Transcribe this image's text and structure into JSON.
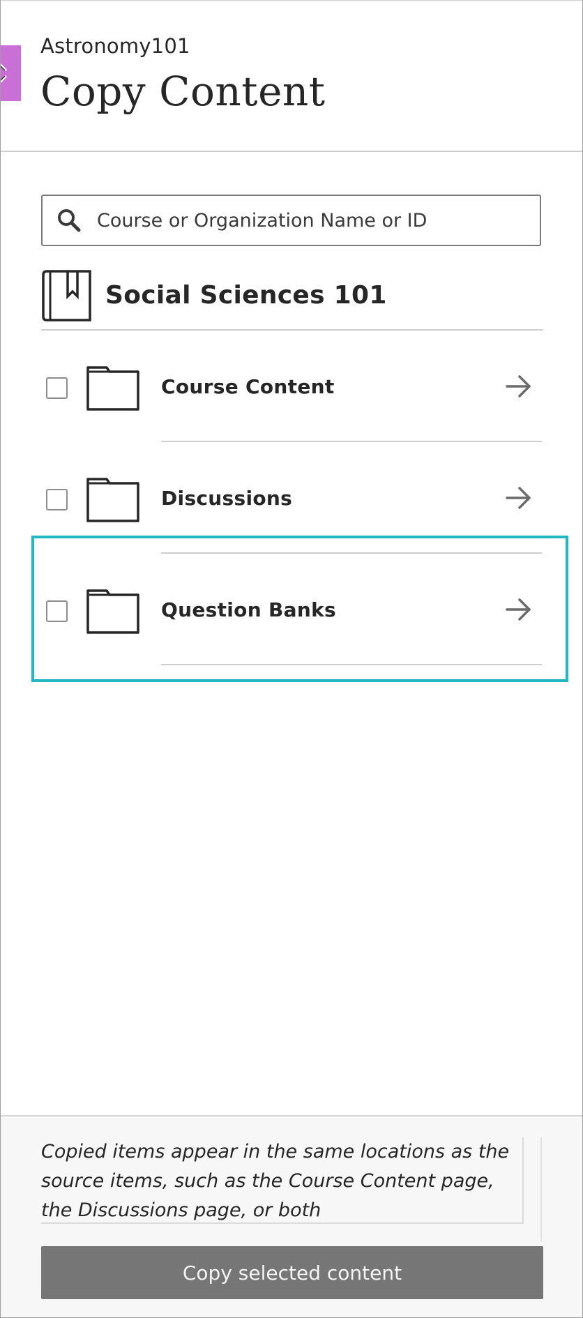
{
  "header": {
    "course_name": "Astronomy101",
    "title": "Copy Content"
  },
  "search": {
    "placeholder": "Course or Organization Name or ID",
    "value": ""
  },
  "source_course": {
    "name": "Social Sciences 101",
    "icon": "book-icon"
  },
  "items": [
    {
      "label": "Course Content",
      "checked": false,
      "icon": "folder-icon",
      "action_icon": "arrow-right-icon"
    },
    {
      "label": "Discussions",
      "checked": false,
      "icon": "folder-icon",
      "action_icon": "arrow-right-icon"
    },
    {
      "label": "Question Banks",
      "checked": false,
      "icon": "folder-icon",
      "action_icon": "arrow-right-icon",
      "focused": true
    }
  ],
  "footer": {
    "note": "Copied items appear in the same locations as the source items, such as the Course Content page, the Discussions page, or both",
    "copy_button_label": "Copy selected content"
  },
  "colors": {
    "close_tab": "#c96fd6",
    "focus_ring": "#21b8c4",
    "disabled_button": "#767676"
  }
}
